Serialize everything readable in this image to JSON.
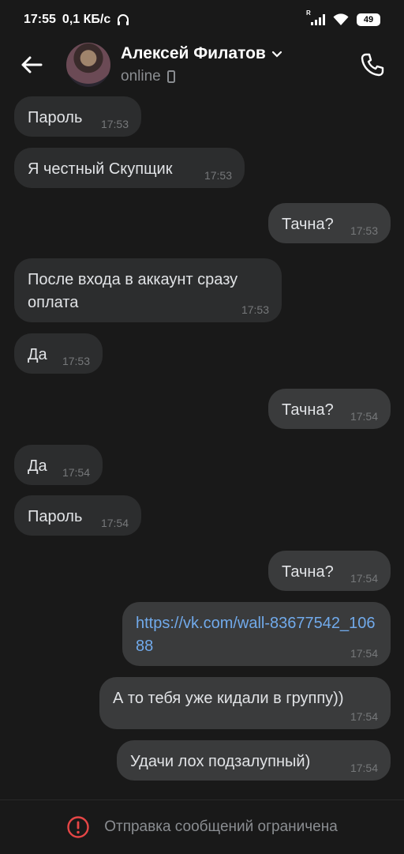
{
  "status_bar": {
    "time": "17:55",
    "speed": "0,1 КБ/с",
    "signal_label": "R",
    "battery": "49"
  },
  "header": {
    "name": "Алексей Филатов",
    "status": "online"
  },
  "messages": [
    {
      "dir": "in",
      "text": "Пароль",
      "time": "17:53"
    },
    {
      "dir": "in",
      "text": "Я честный Скупщик",
      "time": "17:53"
    },
    {
      "dir": "out",
      "text": "Тачна?",
      "time": "17:53"
    },
    {
      "dir": "in",
      "text": "После входа в аккаунт сразу оплата",
      "time": "17:53"
    },
    {
      "dir": "in",
      "text": "Да",
      "time": "17:53"
    },
    {
      "dir": "out",
      "text": "Тачна?",
      "time": "17:54"
    },
    {
      "dir": "in",
      "text": "Да",
      "time": "17:54"
    },
    {
      "dir": "in",
      "text": "Пароль",
      "time": "17:54"
    },
    {
      "dir": "out",
      "text": "Тачна?",
      "time": "17:54"
    },
    {
      "dir": "out",
      "text": "https://vk.com/wall-83677542_10688",
      "time": "17:54"
    },
    {
      "dir": "out",
      "text": "А то тебя уже кидали в группу))",
      "time": "17:54"
    },
    {
      "dir": "out",
      "text": "Удачи лох подзалупный)",
      "time": "17:54"
    }
  ],
  "footer": {
    "text": "Отправка сообщений ограничена"
  },
  "colors": {
    "background": "#191919",
    "bubble_in": "#2c2d2e",
    "bubble_out": "#3a3b3c",
    "link": "#71aaeb",
    "alert": "#e64646"
  }
}
